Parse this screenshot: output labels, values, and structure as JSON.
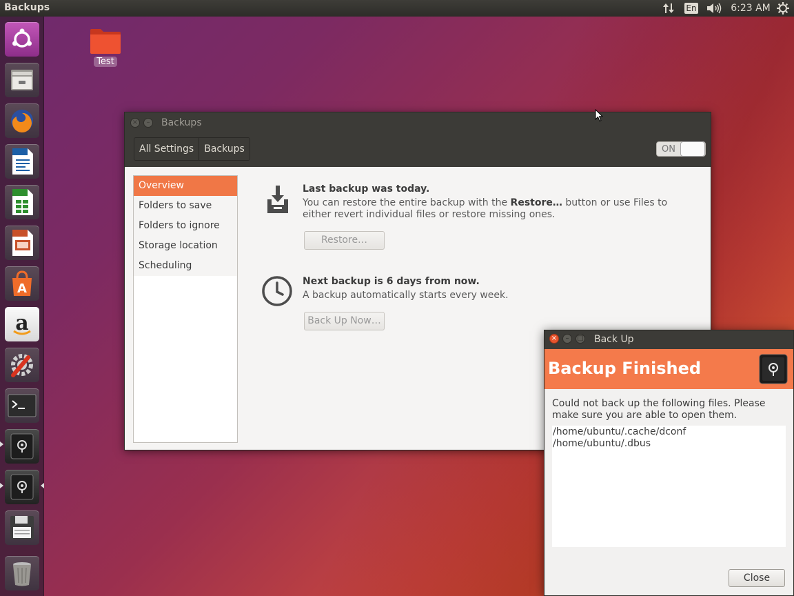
{
  "topbar": {
    "app_title": "Backups",
    "keyboard": "En",
    "clock": "6:23 AM",
    "icons": [
      "network-arrows-icon",
      "keyboard-layout-icon",
      "volume-icon",
      "power-gear-icon"
    ]
  },
  "launcher": {
    "items": [
      "ubuntu-dash-icon",
      "files-icon",
      "firefox-icon",
      "writer-icon",
      "calc-icon",
      "impress-icon",
      "software-center-icon",
      "amazon-icon",
      "system-settings-icon",
      "terminal-icon",
      "backups-icon",
      "backups-icon",
      "save-icon",
      "trash-icon"
    ]
  },
  "desktop": {
    "folder_label": "Test",
    "folder_color": "#e2472a"
  },
  "backups_window": {
    "title": "Backups",
    "breadcrumbs": [
      "All Settings",
      "Backups"
    ],
    "toggle_label": "ON",
    "sidebar": [
      "Overview",
      "Folders to save",
      "Folders to ignore",
      "Storage location",
      "Scheduling"
    ],
    "last_backup": {
      "heading": "Last backup was today.",
      "text_before": "You can restore the entire backup with the ",
      "text_bold": "Restore…",
      "text_after": " button or use Files to",
      "text_line2": "either revert individual files or restore missing ones.",
      "button": "Restore…"
    },
    "next_backup": {
      "heading": "Next backup is 6 days from now.",
      "text": "A backup automatically starts every week.",
      "button": "Back Up Now…"
    }
  },
  "dialog": {
    "title": "Back Up",
    "banner": "Backup Finished",
    "message_line1": "Could not back up the following files.  Please",
    "message_line2": "make sure you are able to open them.",
    "files": [
      "/home/ubuntu/.cache/dconf",
      "/home/ubuntu/.dbus"
    ],
    "close_button": "Close"
  },
  "colors": {
    "accent": "#f07746",
    "banner": "#f47a4b",
    "titlebar": "#3c3b37",
    "close_red": "#e8552e"
  }
}
